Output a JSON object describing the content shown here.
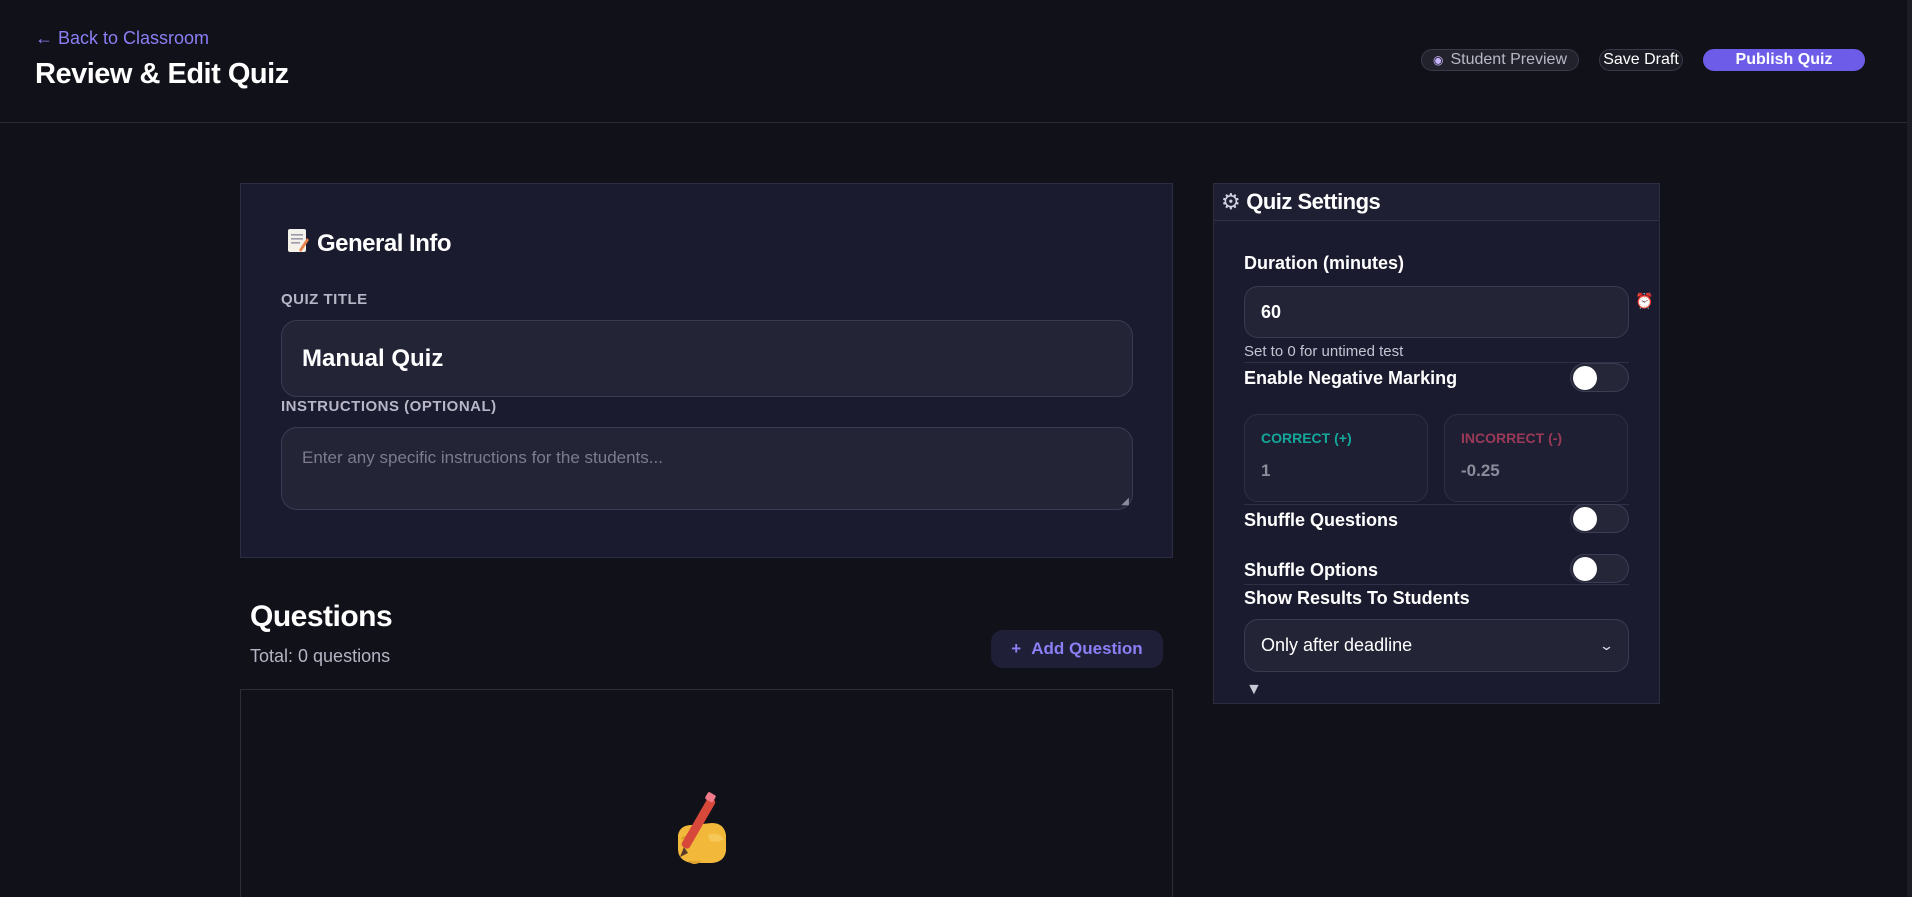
{
  "header": {
    "back_label": "← Back to Classroom",
    "title": "Review & Edit Quiz",
    "preview_label": "Student Preview",
    "draft_label": "Save Draft",
    "publish_label": "Publish Quiz"
  },
  "general": {
    "heading": "General Info",
    "title_label": "QUIZ TITLE",
    "title_value": "Manual Quiz",
    "instructions_label": "INSTRUCTIONS (OPTIONAL)",
    "instructions_placeholder": "Enter any specific instructions for the students..."
  },
  "questions": {
    "heading": "Questions",
    "total": "Total: 0 questions",
    "add_label": "Add Question",
    "add_icon": "+"
  },
  "settings": {
    "heading": "Quiz Settings",
    "duration_label": "Duration (minutes)",
    "duration_value": "60",
    "duration_hint": "Set to 0 for untimed test",
    "negative_label": "Enable Negative Marking",
    "negative_enabled": false,
    "correct_label": "CORRECT (+)",
    "correct_value": "1",
    "incorrect_label": "INCORRECT (-)",
    "incorrect_value": "-0.25",
    "shuffle_questions_label": "Shuffle Questions",
    "shuffle_questions_enabled": false,
    "shuffle_options_label": "Shuffle Options",
    "shuffle_options_enabled": false,
    "results_label": "Show Results To Students",
    "results_value": "Only after deadline"
  },
  "colors": {
    "accent": "#6c5ce7",
    "link": "#8b7ff5",
    "correct": "#14a89a",
    "incorrect": "#9a3a58",
    "background": "#111119",
    "card": "#1a1b2e"
  },
  "icons": {
    "general": "memo-icon",
    "settings": "gear-icon",
    "duration": "alarm-clock-icon",
    "preview": "eye-icon",
    "empty_state": "writing-hand-icon"
  }
}
